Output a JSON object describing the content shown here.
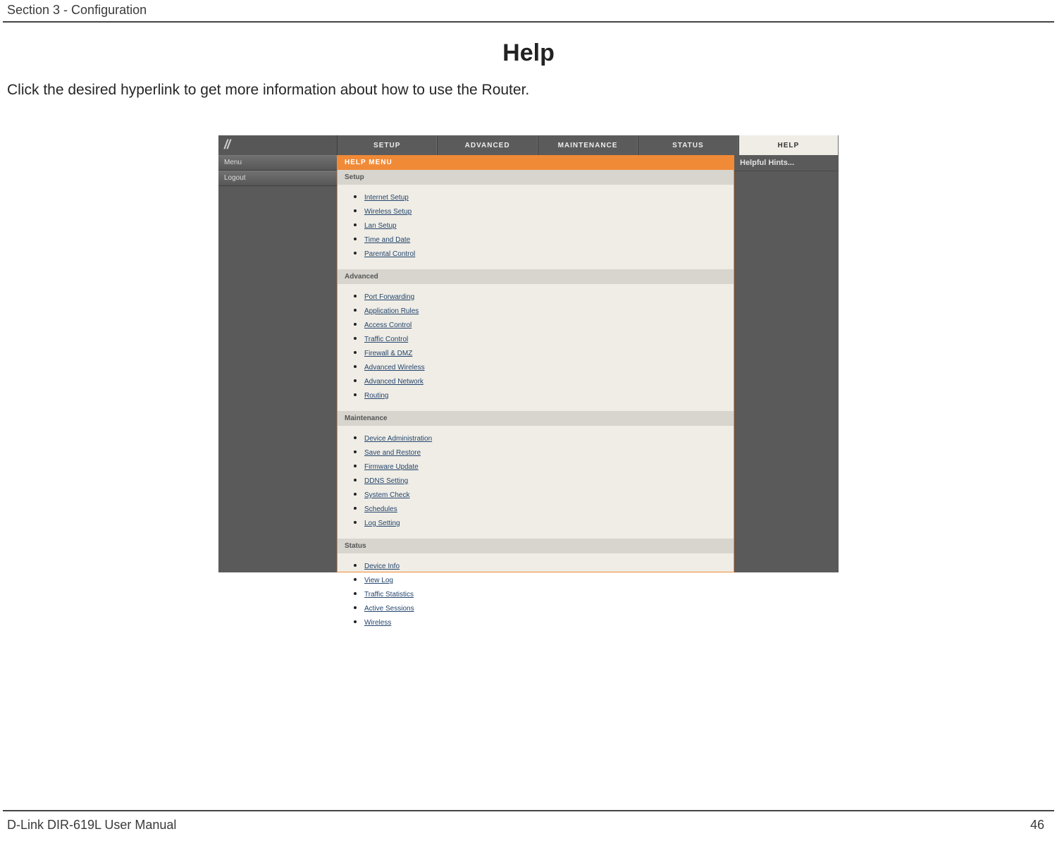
{
  "doc": {
    "section_header": "Section 3 - Configuration",
    "title": "Help",
    "intro": "Click the desired hyperlink to get more information about how to use the Router.",
    "footer_left": "D-Link DIR-619L User Manual",
    "footer_right": "46"
  },
  "tabs": {
    "setup": "SETUP",
    "advanced": "ADVANCED",
    "maintenance": "MAINTENANCE",
    "status": "STATUS",
    "help": "HELP"
  },
  "sidebar": {
    "menu": "Menu",
    "logout": "Logout"
  },
  "help": {
    "bar": "HELP MENU",
    "hints": "Helpful Hints...",
    "sections": {
      "setup": {
        "title": "Setup",
        "links": [
          "Internet Setup",
          "Wireless Setup",
          "Lan Setup",
          "Time and Date",
          "Parental Control"
        ]
      },
      "advanced": {
        "title": "Advanced",
        "links": [
          "Port Forwarding",
          "Application Rules",
          "Access Control",
          "Traffic Control",
          "Firewall & DMZ",
          "Advanced Wireless",
          "Advanced Network",
          "Routing"
        ]
      },
      "maintenance": {
        "title": "Maintenance",
        "links": [
          "Device Administration",
          "Save and Restore",
          "Firmware Update",
          "DDNS Setting",
          "System Check",
          "Schedules",
          "Log Setting"
        ]
      },
      "status": {
        "title": "Status",
        "links": [
          "Device Info",
          "View Log",
          "Traffic Statistics",
          "Active Sessions",
          "Wireless"
        ]
      }
    }
  }
}
